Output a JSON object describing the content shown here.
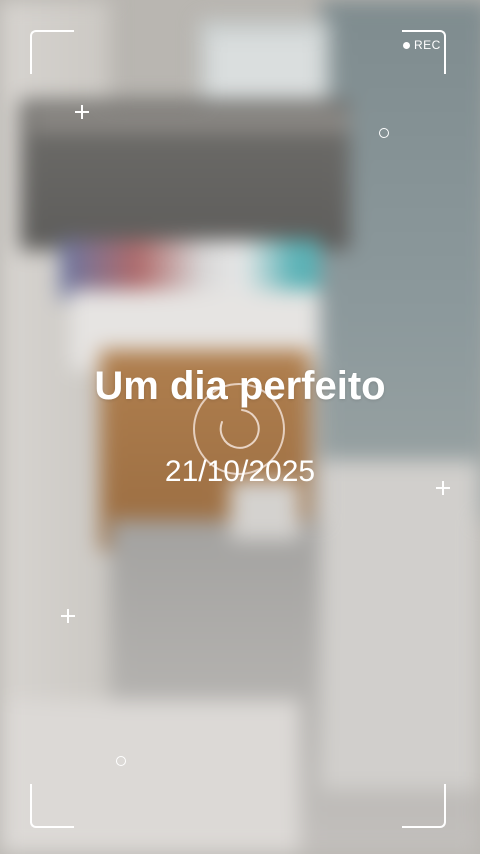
{
  "recording": {
    "label": "REC"
  },
  "overlay": {
    "title": "Um dia perfeito",
    "date": "21/10/2025"
  },
  "icons": [
    "record-dot-icon",
    "plus-icon",
    "ring-icon",
    "focus-circle-icon"
  ]
}
